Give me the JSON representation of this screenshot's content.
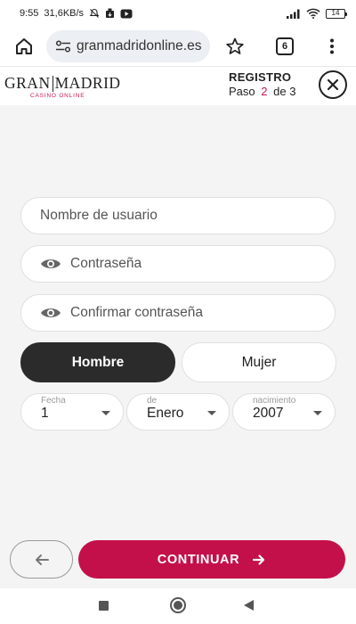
{
  "status_bar": {
    "time": "9:55",
    "network_speed": "31,6KB/s",
    "battery_level": "14",
    "icons": [
      "mute-icon",
      "download-icon",
      "youtube-icon",
      "signal-icon",
      "wifi-icon",
      "battery-icon"
    ]
  },
  "browser": {
    "url": "granmadridonline.es",
    "tabs_count": "6",
    "icons": [
      "home-icon",
      "site-settings-icon",
      "bookmark-star-icon",
      "tabs-icon",
      "more-menu-icon"
    ]
  },
  "header": {
    "logo_left": "GRAN",
    "logo_right": "MADRID",
    "logo_sub": "CASINO ONLINE",
    "title": "REGISTRO",
    "step_prefix": "Paso",
    "step_current": "2",
    "step_sep": "de",
    "step_total": "3",
    "icons": [
      "close-icon"
    ]
  },
  "form": {
    "username_placeholder": "Nombre de usuario",
    "password_placeholder": "Contraseña",
    "confirm_placeholder": "Confirmar contraseña",
    "gender_options": [
      "Hombre",
      "Mujer"
    ],
    "gender_selected": "Hombre",
    "birth_labels": [
      "Fecha",
      "de",
      "nacimiento"
    ],
    "birth_day": "1",
    "birth_month": "Enero",
    "birth_year": "2007"
  },
  "actions": {
    "continue_label": "CONTINUAR",
    "icons": [
      "back-arrow-icon",
      "forward-arrow-icon"
    ]
  },
  "colors": {
    "brand": "#c4104a",
    "active_toggle": "#2b2b2b",
    "background": "#f4f4f4"
  }
}
